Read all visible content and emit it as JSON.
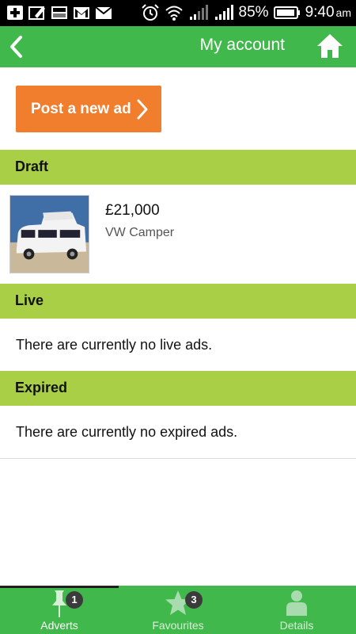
{
  "status_bar": {
    "battery_percent": "85%",
    "time": "9:40",
    "ampm": "am"
  },
  "header": {
    "title": "My account"
  },
  "actions": {
    "post_ad_label": "Post a new ad"
  },
  "sections": {
    "draft": {
      "title": "Draft",
      "ad": {
        "price": "£21,000",
        "name": "VW Camper"
      }
    },
    "live": {
      "title": "Live",
      "empty_message": "There are currently no live ads."
    },
    "expired": {
      "title": "Expired",
      "empty_message": "There are currently no expired ads."
    }
  },
  "bottom_nav": {
    "tabs": [
      {
        "label": "Adverts",
        "badge": "1"
      },
      {
        "label": "Favourites",
        "badge": "3"
      },
      {
        "label": "Details"
      }
    ]
  },
  "colors": {
    "appbar_green": "#41b84b",
    "section_green": "#a8cf45",
    "post_button_orange": "#f07e2d"
  }
}
